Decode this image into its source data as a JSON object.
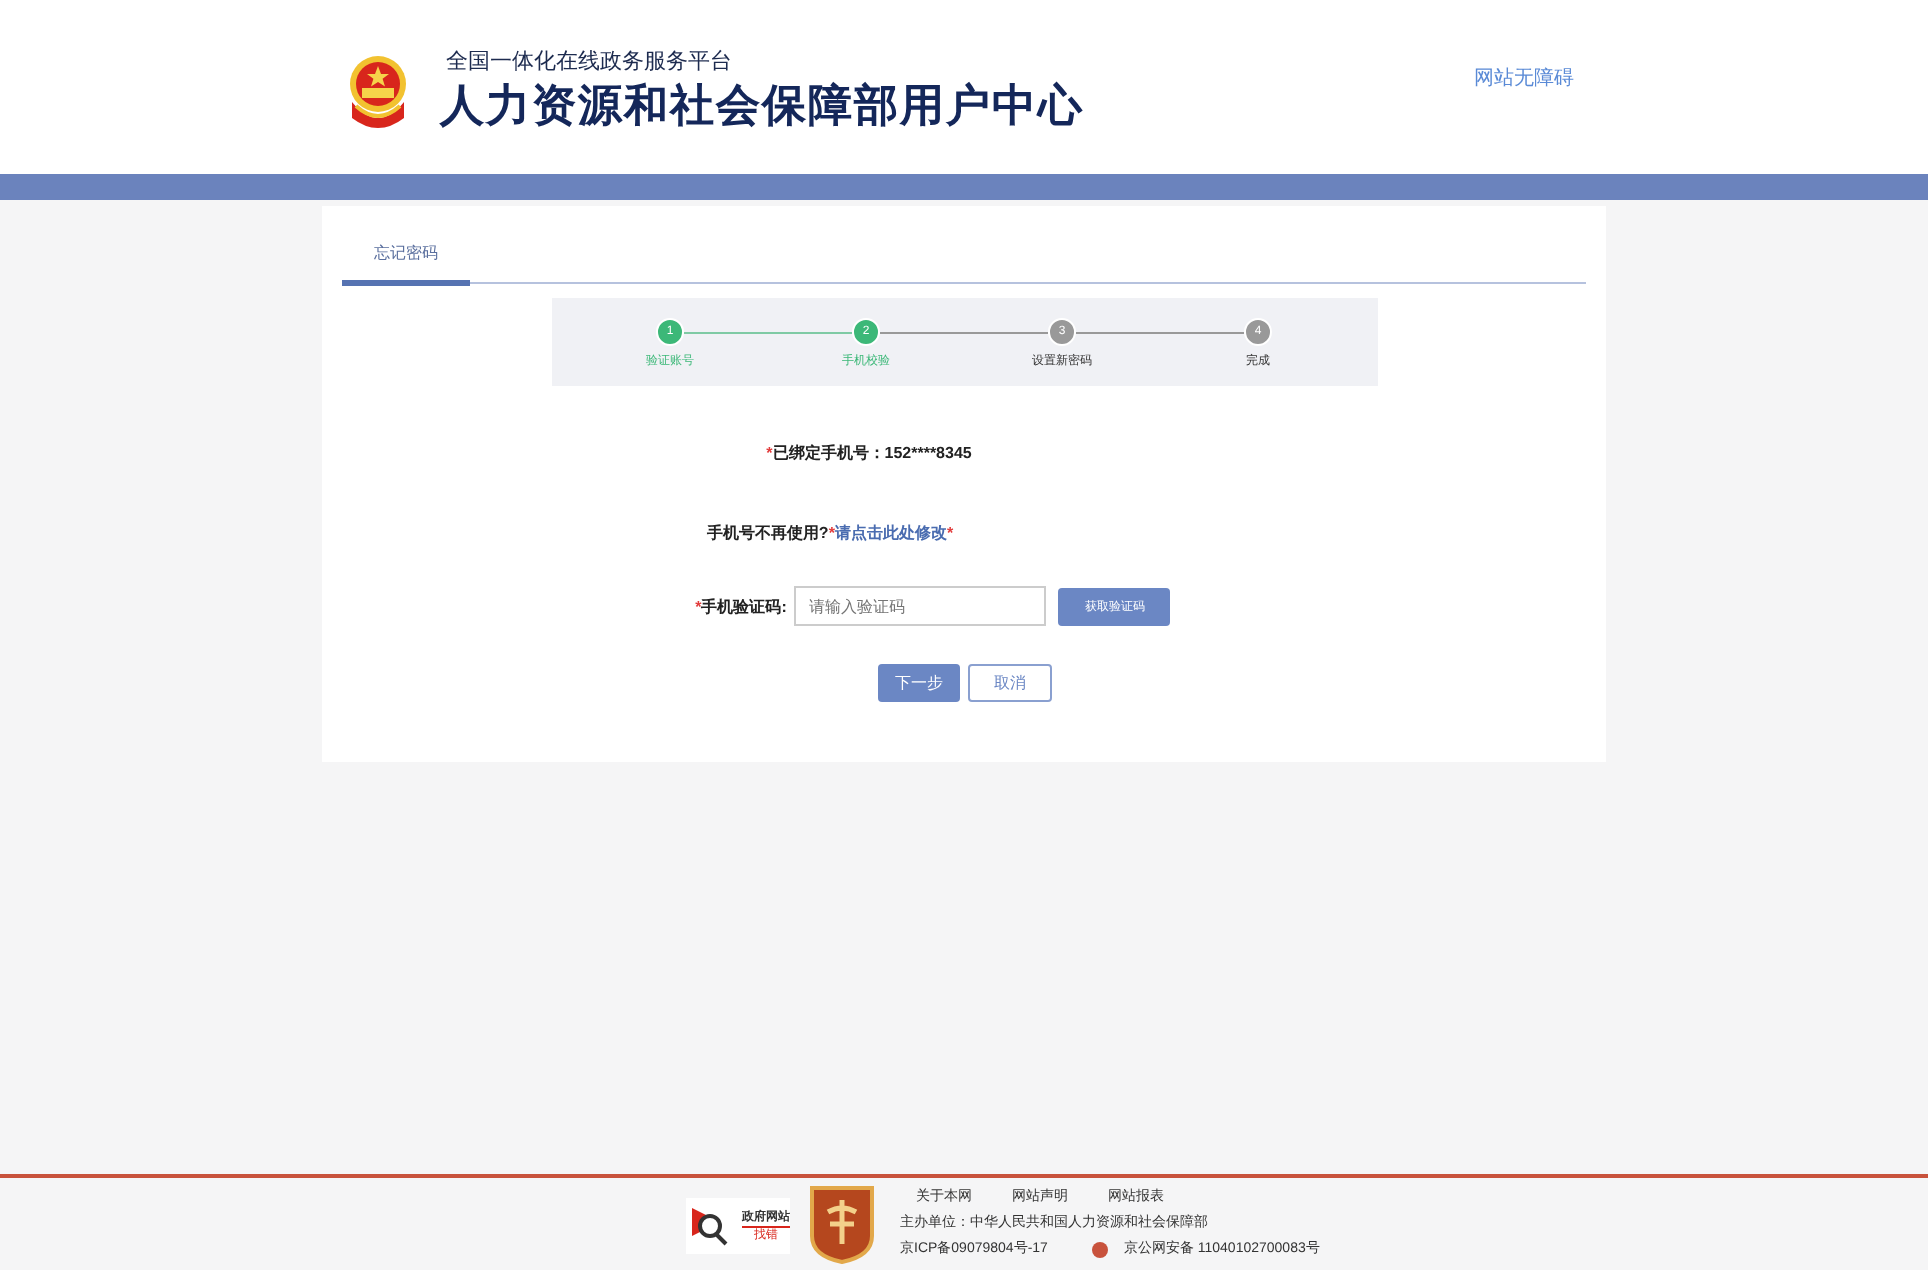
{
  "header": {
    "subtitle": "全国一体化在线政务服务平台",
    "title": "人力资源和社会保障部用户中心",
    "accessibility_link": "网站无障碍"
  },
  "tabs": [
    {
      "label": "忘记密码",
      "selected": true
    }
  ],
  "steps": [
    {
      "number": "1",
      "label": "验证账号",
      "done": true
    },
    {
      "number": "2",
      "label": "手机校验",
      "done": true
    },
    {
      "number": "3",
      "label": "设置新密码",
      "done": false
    },
    {
      "number": "4",
      "label": "完成",
      "done": false
    }
  ],
  "form": {
    "bound_phone_label": "已绑定手机号：",
    "bound_phone_value": "152****8345",
    "change_prompt": "手机号不再使用?",
    "change_link": "请点击此处修改",
    "code_label": "手机验证码:",
    "code_placeholder": "请输入验证码",
    "get_code_button": "获取验证码",
    "next_button": "下一步",
    "cancel_button": "取消",
    "required_mark": "*"
  },
  "footer": {
    "badge_top": "政府网站",
    "badge_bottom": "找错",
    "links": [
      "关于本网",
      "网站声明",
      "网站报表"
    ],
    "sponsor": "主办单位：中华人民共和国人力资源和社会保障部",
    "icp": "京ICP备09079804号-17",
    "police": "京公网安备 11040102700083号"
  }
}
